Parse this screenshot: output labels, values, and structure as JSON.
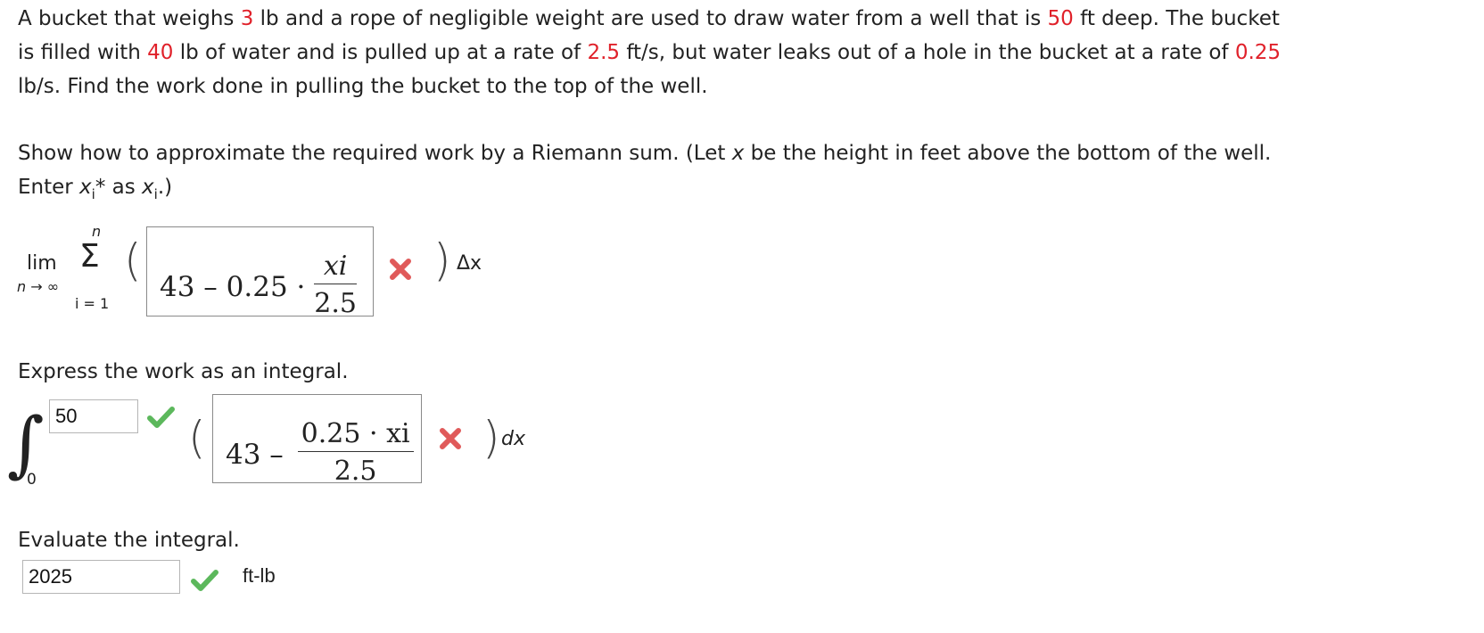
{
  "problem": {
    "p1": "A bucket that weighs ",
    "weight": "3",
    "p2": " lb and a rope of negligible weight are used to draw water from a well that is ",
    "depth": "50",
    "p3": " ft deep. The bucket",
    "p4": "is filled with ",
    "water": "40",
    "p5": " lb of water and is pulled up at a rate of ",
    "rate": "2.5",
    "p6": " ft/s, but water leaks out of a hole in the bucket at a rate of ",
    "leak": "0.25",
    "p7": "lb/s. Find the work done in pulling the bucket to the top of the well."
  },
  "part1": {
    "instr1a": "Show how to approximate the required work by a Riemann sum. (Let ",
    "instr1x": "x",
    "instr1b": " be the height in feet above the bottom of the well.",
    "instr2a": "Enter ",
    "instr2x": "x",
    "instr2i": "i",
    "instr2b": "* as ",
    "instr2x2": "x",
    "instr2i2": "i",
    "instr2c": ".)",
    "lim": "lim",
    "lim_sub": "n → ∞",
    "sum_top": "n",
    "sum_sym": "Σ",
    "sum_bottom": "i = 1",
    "answer_const": "43 – 0.25 ·",
    "answer_num": "xi",
    "answer_den": "2.5",
    "status": "incorrect",
    "delta": "Δx"
  },
  "part2": {
    "instr": "Express the work as an integral.",
    "integral_sym": "∫",
    "upper_limit": "50",
    "upper_status": "correct",
    "lower_limit": "0",
    "answer_const": "43 –",
    "answer_num": "0.25 · xi",
    "answer_den": "2.5",
    "status": "incorrect",
    "dx": "dx"
  },
  "part3": {
    "instr": "Evaluate the integral.",
    "value": "2025",
    "status": "correct",
    "unit": "ft-lb"
  },
  "colors": {
    "highlight": "#e0212a",
    "correct": "#5cb85c",
    "incorrect": "#e05a5a"
  }
}
